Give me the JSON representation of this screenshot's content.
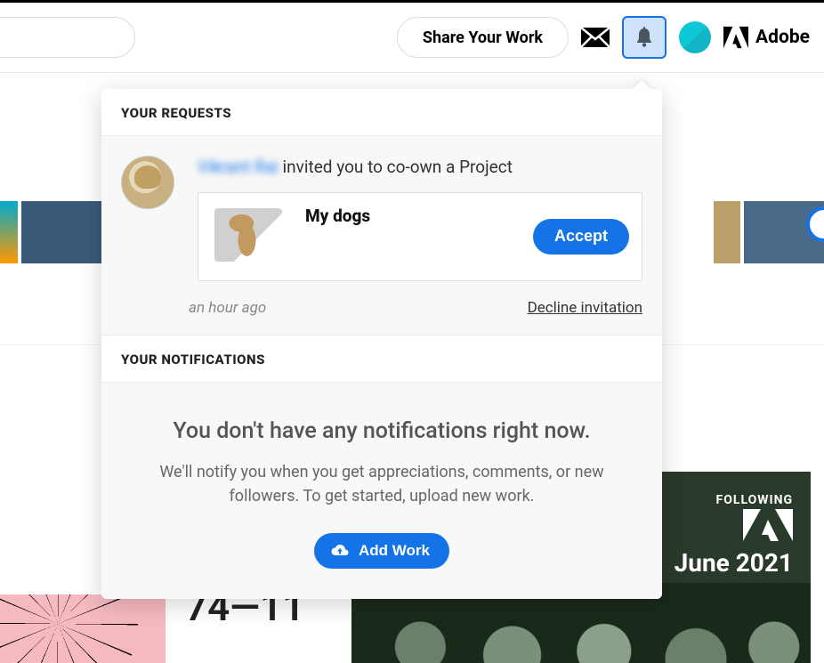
{
  "header": {
    "share_label": "Share Your Work",
    "brand": "Adobe"
  },
  "popover": {
    "requests": {
      "header": "YOUR REQUESTS",
      "inviter_name": "Vikrant Rai",
      "invite_text_suffix": " invited you to co-own a Project",
      "project_title": "My dogs",
      "accept_label": "Accept",
      "timestamp": "an hour ago",
      "decline_label": "Decline invitation"
    },
    "notifications": {
      "header": "YOUR NOTIFICATIONS",
      "empty_title": "You don't have any notifications right now.",
      "empty_subtitle": "We'll notify you when you get appreciations, comments, or new followers. To get started, upload new work.",
      "add_work_label": "Add Work"
    }
  },
  "background": {
    "bottom_mid_text": "74—11",
    "following_label": "FOLLOWING",
    "month_label": "June 2021"
  }
}
